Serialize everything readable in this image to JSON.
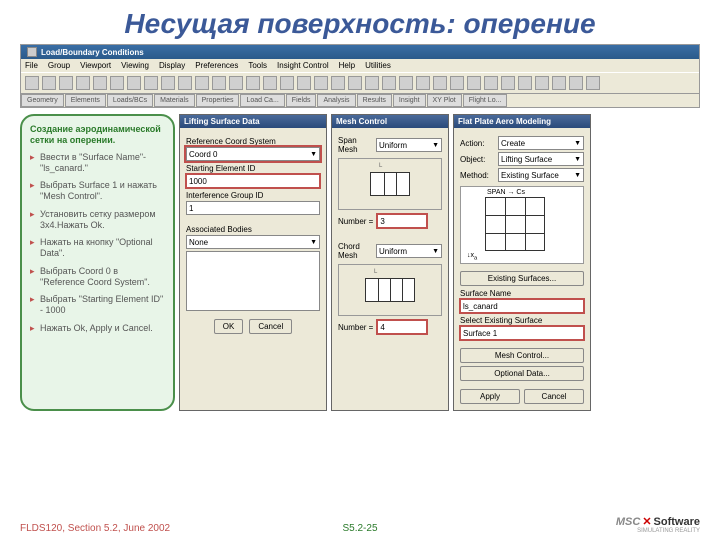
{
  "slide_title": "Несущая поверхность: оперение",
  "window_title": "Load/Boundary Conditions",
  "menus": [
    "File",
    "Group",
    "Viewport",
    "Viewing",
    "Display",
    "Preferences",
    "Tools",
    "Insight Control",
    "Help",
    "Utilities"
  ],
  "tabs": [
    "Geometry",
    "Elements",
    "Loads/BCs",
    "Materials",
    "Properties",
    "Load Ca...",
    "Fields",
    "Analysis",
    "Results",
    "Insight",
    "XY Plot",
    "Flight Lo..."
  ],
  "instructions": {
    "heading": "Создание аэродинамической сетки на оперении.",
    "items": [
      "Ввести в \"Surface Name\"-\"ls_canard.\"",
      "Выбрать Surface 1 и нажать \"Mesh Control\".",
      "Установить сетку размером 3x4.Нажать Ok.",
      "Нажать на кнопку \"Optional Data\".",
      "Выбрать Coord 0 в \"Reference Coord System\".",
      "Выбрать \"Starting Element ID\" - 1000",
      "Нажать Ok, Apply и Cancel."
    ]
  },
  "panel_lsd": {
    "title": "Lifting Surface Data",
    "ref_label": "Reference Coord System",
    "ref_value": "Coord 0",
    "sid_label": "Starting Element ID",
    "sid_value": "1000",
    "ig_label": "Interference Group ID",
    "ig_value": "1",
    "ab_label": "Associated Bodies",
    "ab_value": "None",
    "ok": "OK",
    "cancel": "Cancel"
  },
  "panel_mc": {
    "title": "Mesh Control",
    "span_label": "Span Mesh",
    "span_value": "Uniform",
    "chord_label": "Chord Mesh",
    "chord_value": "Uniform",
    "number_label": "Number =",
    "span_num": "3",
    "chord_num": "4"
  },
  "panel_fp": {
    "title": "Flat Plate Aero Modeling",
    "action_label": "Action:",
    "action_value": "Create",
    "object_label": "Object:",
    "object_value": "Lifting Surface",
    "method_label": "Method:",
    "method_value": "Existing Surface",
    "diag_span": "SPAN → Cs",
    "existing_btn": "Existing Surfaces...",
    "sname_label": "Surface Name",
    "sname_value": "ls_canard",
    "sel_label": "Select Existing Surface",
    "sel_value": "Surface 1",
    "mesh_btn": "Mesh Control...",
    "opt_btn": "Optional Data...",
    "apply": "Apply",
    "cancel": "Cancel"
  },
  "footer": {
    "left": "FLDS120, Section 5.2, June 2002",
    "mid": "S5.2-25",
    "logo_msc": "MSC",
    "logo_sw": "Software"
  }
}
